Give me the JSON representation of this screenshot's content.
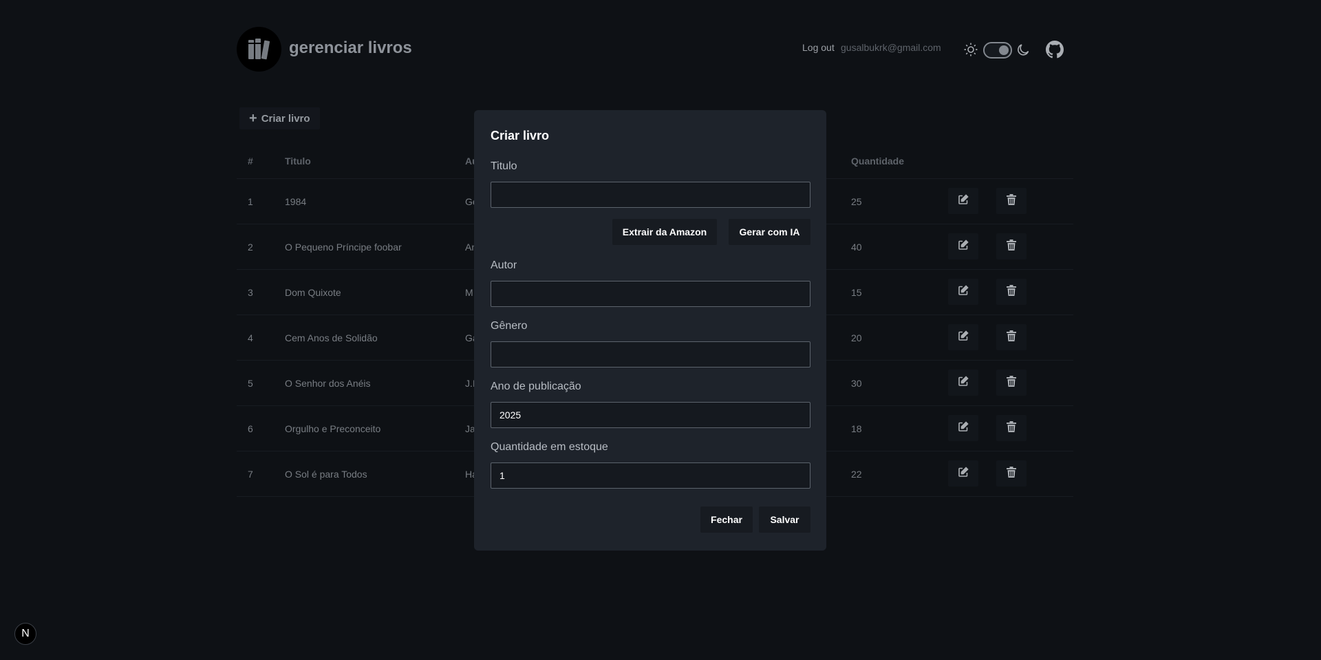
{
  "header": {
    "title": "gerenciar livros",
    "logout_label": "Log out",
    "email": "gusalbukrk@gmail.com"
  },
  "toolbar": {
    "create_label": "Criar livro"
  },
  "table": {
    "columns": [
      "#",
      "Titulo",
      "Au",
      "Quantidade"
    ],
    "rows": [
      {
        "num": "1",
        "title": "1984",
        "author": "Ge",
        "qty": "25"
      },
      {
        "num": "2",
        "title": "O Pequeno Príncipe foobar",
        "author": "An",
        "qty": "40"
      },
      {
        "num": "3",
        "title": "Dom Quixote",
        "author": "M",
        "qty": "15"
      },
      {
        "num": "4",
        "title": "Cem Anos de Solidão",
        "author": "Ga",
        "qty": "20"
      },
      {
        "num": "5",
        "title": "O Senhor dos Anéis",
        "author": "J.I",
        "qty": "30"
      },
      {
        "num": "6",
        "title": "Orgulho e Preconceito",
        "author": "Ja",
        "qty": "18"
      },
      {
        "num": "7",
        "title": "O Sol é para Todos",
        "author": "Ha",
        "qty": "22"
      }
    ]
  },
  "modal": {
    "title": "Criar livro",
    "fields": {
      "titulo": {
        "label": "Titulo",
        "value": ""
      },
      "autor": {
        "label": "Autor",
        "value": ""
      },
      "genero": {
        "label": "Gênero",
        "value": ""
      },
      "ano": {
        "label": "Ano de publicação",
        "value": "2025"
      },
      "quantidade": {
        "label": "Quantidade em estoque",
        "value": "1"
      }
    },
    "extract_amazon_label": "Extrair da Amazon",
    "generate_ai_label": "Gerar com IA",
    "close_label": "Fechar",
    "save_label": "Salvar"
  },
  "badge": {
    "letter": "N"
  },
  "icons": {
    "logo": "books-icon",
    "theme_light": "sun-icon",
    "theme_dark": "moon-icon",
    "repo": "github-icon",
    "edit": "edit-icon",
    "delete": "trash-icon",
    "add": "plus-icon"
  },
  "colors": {
    "background": "#111419",
    "modal": "#1e232b",
    "button": "#171b21"
  }
}
